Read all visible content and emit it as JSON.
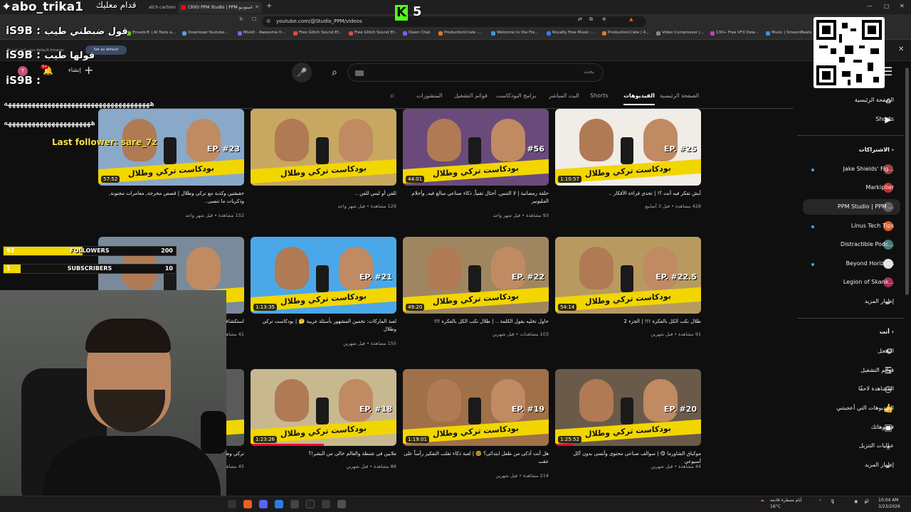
{
  "browser": {
    "tabs": [
      {
        "label": "atch cartoon",
        "active": false
      },
      {
        "label": "(300) PPM Studio | PPM استوديو",
        "active": true
      }
    ],
    "url": "youtube.com/@Studio_PPM/videos",
    "bookmarks": [
      {
        "label": "Envato® | AI Tools a...",
        "color": "#7cbf2f"
      },
      {
        "label": "Download Youtube...",
        "color": "#5aa0e0"
      },
      {
        "label": "Mixkit - Awesome fr...",
        "color": "#8a5cf0"
      },
      {
        "label": "Free Glitch Sound Ef...",
        "color": "#e04848"
      },
      {
        "label": "Free Glitch Sound Ef...",
        "color": "#e04848"
      },
      {
        "label": "Qwen Chat",
        "color": "#6a6af0"
      },
      {
        "label": "ProductionCrate -...",
        "color": "#e07a2a"
      },
      {
        "label": "Welcome to the Fre...",
        "color": "#3a9ae0"
      },
      {
        "label": "Royalty Free Music -...",
        "color": "#3a7ae0"
      },
      {
        "label": "ProductionCrate | 4...",
        "color": "#e07a2a"
      },
      {
        "label": "Video Compressor |...",
        "color": "#888888"
      },
      {
        "label": "130+ Free VFX Dow...",
        "color": "#c040c0"
      },
      {
        "label": "Music | StreamBeats",
        "color": "#4a8ae0"
      }
    ],
    "notice_text": "Brave isn't your default browser",
    "notice_button": "Set as default"
  },
  "youtube": {
    "search_placeholder": "بحث",
    "create_label": "إنشاء",
    "notif_count": "9+",
    "avatar_letter": "T",
    "channel_tabs": [
      {
        "label": "الصفحة الرئيسية",
        "active": false
      },
      {
        "label": "الفيديوهات",
        "active": true
      },
      {
        "label": "Shorts",
        "active": false
      },
      {
        "label": "البث المباشر",
        "active": false
      },
      {
        "label": "برامج البودكاست",
        "active": false
      },
      {
        "label": "قوائم التشغيل",
        "active": false
      },
      {
        "label": "المنشورات",
        "active": false
      }
    ],
    "videos": [
      {
        "title": "أيش تفكر فيه أنت ؟! | تحدي قراءة الأفكار ..",
        "meta": "428 مشاهدة • قبل 3 أسابيع",
        "duration": "1:10:57",
        "ep": "EP. #25",
        "bg": "#f0ece6",
        "progress": 0
      },
      {
        "title": "حلقة رمضانية | لا التنس, أحتال تقنياً, ذكاء صناعي مبالغ فيه, وأحلام المليونير",
        "meta": "93 مشاهدة • قبل شهر واحد",
        "duration": "44:01",
        "ep": "#56",
        "bg": "#6a4a7a",
        "progress": 0
      },
      {
        "title": "للفن أو ليس للفن ..",
        "meta": "129 مشاهدة • قبل شهر واحد",
        "duration": "",
        "ep": "",
        "bg": "#c8a860",
        "progress": 0
      },
      {
        "title": "حقيقتين وكذبة مع تركي وطلال | قصص محرجة, مغامرات مجنونة, وذكريات ما تنسى..",
        "meta": "152 مشاهدة • قبل شهر واحد",
        "duration": "57:52",
        "ep": "EP. #23",
        "bg": "#8aa8c8",
        "progress": 0
      },
      {
        "title": "طلال نكب الكل بالفكرة !!! | الجزء 2",
        "meta": "91 مشاهدة • قبل شهرين",
        "duration": "54:14",
        "ep": "EP. #22.5",
        "bg": "#b89a60",
        "progress": 0
      },
      {
        "title": "حاول تخليه يقول الكلمة .. | طلال نكب الكل بالفكرة !!!",
        "meta": "103 مشاهدات • قبل شهرين",
        "duration": "49:20",
        "ep": "EP. #22",
        "bg": "#a08660",
        "progress": 0
      },
      {
        "title": "لعبة الماركات: تخمين المشهور بأسئلة غريبة 🤔 | بودكاست تركي وطلال",
        "meta": "155 مشاهدة • قبل شهرين",
        "duration": "1:13:35",
        "ep": "EP. #21",
        "bg": "#4aa8e8",
        "progress": 0
      },
      {
        "title": "استكشاف مهارات",
        "meta": "41 مشاهدة",
        "duration": "",
        "ep": "",
        "bg": "#7a8a9a",
        "progress": 0
      },
      {
        "title": "موكباق الشاورما 😋 | سوالف صناعي محتوى وأنسي بدون أكل أسبوعي",
        "meta": "44 مشاهدة • قبل شهرين",
        "duration": "1:25:52",
        "ep": "EP. #20",
        "bg": "#6a5a4a",
        "progress": 0.12
      },
      {
        "title": "هل أنت أذكى من طفل ابتدائي؟ 🤓 | لعبة ذكاء تقلب التفكير رأساً على عقب",
        "meta": "214 مشاهدة • قبل شهرين",
        "duration": "1:19:01",
        "ep": "EP. #19",
        "bg": "#a07048",
        "progress": 0
      },
      {
        "title": "ملايين في شنطة والعالم خالي من البشر!؟",
        "meta": "86 مشاهدة • قبل شهرين",
        "duration": "1:23:26",
        "ep": "EP. #18",
        "bg": "#c8b890",
        "progress": 0.5
      },
      {
        "title": "تركي وطلال",
        "meta": "45 مشاهدة",
        "duration": "",
        "ep": "",
        "bg": "#5a5a5a",
        "progress": 0
      }
    ],
    "sidebar": {
      "top": [
        {
          "label": "الصفحة الرئيسية",
          "icon": "home-icon",
          "glyph": "⌂"
        },
        {
          "label": "Shorts",
          "icon": "shorts-icon",
          "glyph": "▶"
        }
      ],
      "subs_header": "الاشتراكات",
      "subs": [
        {
          "label": "Jake Shields' Fig...",
          "color": "#a04040",
          "dot": true
        },
        {
          "label": "Markiplier",
          "color": "#c03030",
          "dot": false
        },
        {
          "label": "PPM Studio | PPM ...",
          "color": "#606060",
          "dot": false
        },
        {
          "label": "Linus Tech Tips",
          "color": "#e05a20",
          "dot": true
        },
        {
          "label": "Distractible Podc...",
          "color": "#4a7a7a",
          "dot": false
        },
        {
          "label": "Beyond Horizons",
          "color": "#e0e0e0",
          "dot": true
        },
        {
          "label": "Legion of Skank...",
          "color": "#a03050",
          "dot": false
        }
      ],
      "show_more": "إظهار المزيد",
      "you_header": "أنت",
      "you": [
        {
          "label": "السجل",
          "icon": "history-icon",
          "glyph": "⟲"
        },
        {
          "label": "قوائم التشغيل",
          "icon": "playlists-icon",
          "glyph": "☰"
        },
        {
          "label": "المشاهدة لاحقًا",
          "icon": "watch-later-icon",
          "glyph": "◷"
        },
        {
          "label": "الفيديوهات التي أعجبتني",
          "icon": "like-icon",
          "glyph": "👍"
        },
        {
          "label": "فيديوهاتك",
          "icon": "your-videos-icon",
          "glyph": "▣"
        },
        {
          "label": "عمليات التنزيل",
          "icon": "download-icon",
          "glyph": "⤓"
        }
      ],
      "show_more2": "إظهار المزيد"
    }
  },
  "overlay": {
    "username": "abo_trika1",
    "user_msg": "قدام معليك",
    "kick_count": "5",
    "chat": [
      {
        "user": "iS9B",
        "msg": "قول ضبطني طيب"
      },
      {
        "user": "iS9B",
        "msg": "قولها طيب"
      },
      {
        "user": "iS9B",
        "msg": ""
      }
    ],
    "spam1": "هههههههههههههههههههههههههههههههههههههه",
    "spam2": "ههههههههههههههههههههههه",
    "last_follower": "Last follower: sare_7z",
    "followers": {
      "label": "FOLLOWERS",
      "current": "92",
      "goal": "200",
      "fraction": 0.46
    },
    "subscribers": {
      "label": "SUBSCRIBERS",
      "current": "1",
      "goal": "10",
      "fraction": 0.1
    }
  },
  "taskbar": {
    "weather": "أيام ممطرة قادمة",
    "temp": "16°C",
    "time": "10:04 AM",
    "date": "3/23/2026"
  }
}
